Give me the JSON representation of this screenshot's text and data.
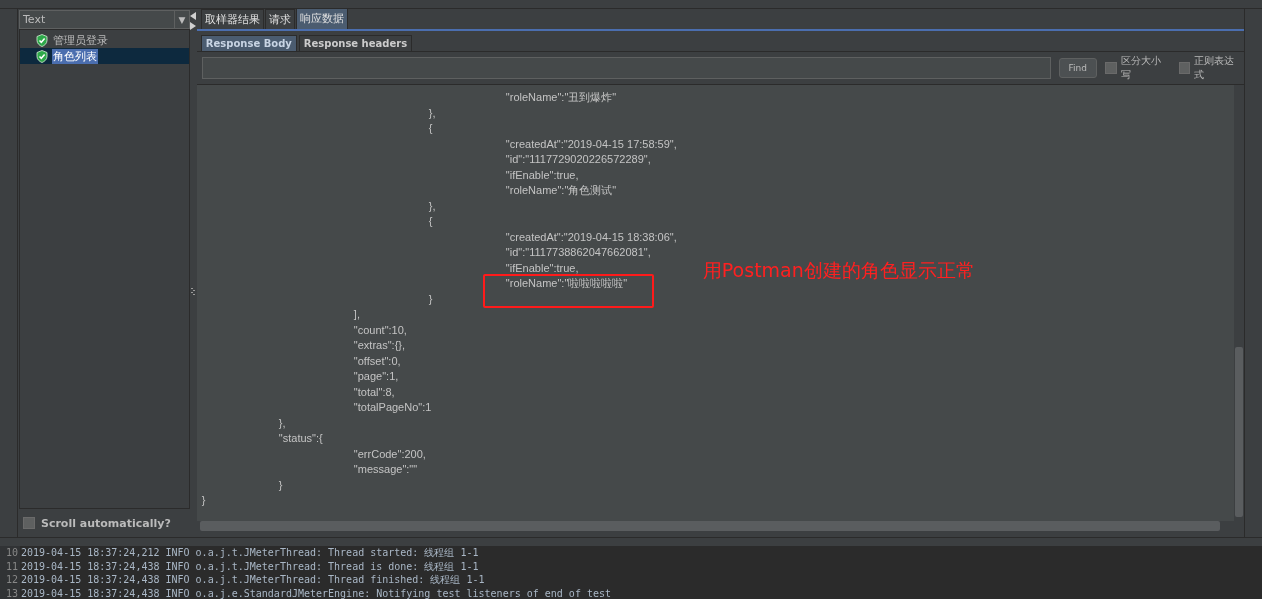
{
  "results_tree": {
    "renderer": "Text",
    "dropdown_arrow": "▼",
    "items": [
      {
        "label": "管理员登录",
        "selected": false
      },
      {
        "label": "角色列表",
        "selected": true
      }
    ],
    "scroll_automatically": {
      "label": "Scroll automatically?",
      "checked": false
    }
  },
  "tabs": [
    {
      "label": "取样器结果",
      "selected": false
    },
    {
      "label": "请求",
      "selected": false
    },
    {
      "label": "响应数据",
      "selected": true
    }
  ],
  "subtabs": [
    {
      "label": "Response Body",
      "selected": true
    },
    {
      "label": "Response headers",
      "selected": false
    }
  ],
  "search": {
    "button": "Find",
    "options": [
      {
        "label": "区分大小写",
        "checked": false
      },
      {
        "label": "正则表达式",
        "checked": false
      }
    ]
  },
  "response_body": [
    {
      "children": [
        {
          "children": [
            {
              "children": [
                {
                  "children": [
                    {
                      "text": "\"roleName\":\"丑到爆炸\""
                    }
                  ]
                },
                {
                  "text": "},"
                },
                {
                  "text": "{"
                },
                {
                  "children": [
                    {
                      "text": "\"createdAt\":\"2019-04-15 17:58:59\","
                    },
                    {
                      "text": "\"id\":\"1117729020226572289\","
                    },
                    {
                      "text": "\"ifEnable\":true,"
                    },
                    {
                      "text": "\"roleName\":\"角色测试\""
                    }
                  ]
                },
                {
                  "text": "},"
                },
                {
                  "text": "{"
                },
                {
                  "children": [
                    {
                      "text": "\"createdAt\":\"2019-04-15 18:38:06\","
                    },
                    {
                      "text": "\"id\":\"1117738862047662081\","
                    },
                    {
                      "text": "\"ifEnable\":true,"
                    },
                    {
                      "text": "\"roleName\":\"啦啦啦啦啦\"",
                      "highlighted": true
                    }
                  ]
                },
                {
                  "text": "}"
                }
              ]
            },
            {
              "text": "],"
            },
            {
              "text": "\"count\":10,"
            },
            {
              "text": "\"extras\":{},"
            },
            {
              "text": "\"offset\":0,"
            },
            {
              "text": "\"page\":1,"
            },
            {
              "text": "\"total\":8,"
            },
            {
              "text": "\"totalPageNo\":1"
            }
          ]
        },
        {
          "text": "},"
        },
        {
          "text": "\"status\":{"
        },
        {
          "children": [
            {
              "text": "\"errCode\":200,"
            },
            {
              "text": "\"message\":\"\""
            }
          ]
        },
        {
          "text": "}"
        }
      ]
    },
    {
      "text": "}"
    }
  ],
  "annotation": {
    "text": "用Postman创建的角色显示正常"
  },
  "log": [
    {
      "line": "10",
      "text": "2019-04-15 18:37:24,212 INFO o.a.j.t.JMeterThread: Thread started: 线程组 1-1"
    },
    {
      "line": "11",
      "text": "2019-04-15 18:37:24,438 INFO o.a.j.t.JMeterThread: Thread is done: 线程组 1-1"
    },
    {
      "line": "12",
      "text": "2019-04-15 18:37:24,438 INFO o.a.j.t.JMeterThread: Thread finished: 线程组 1-1"
    },
    {
      "line": "13",
      "text": "2019-04-15 18:37:24,438 INFO o.a.j.e.StandardJMeterEngine: Notifying test listeners of end of test"
    }
  ]
}
